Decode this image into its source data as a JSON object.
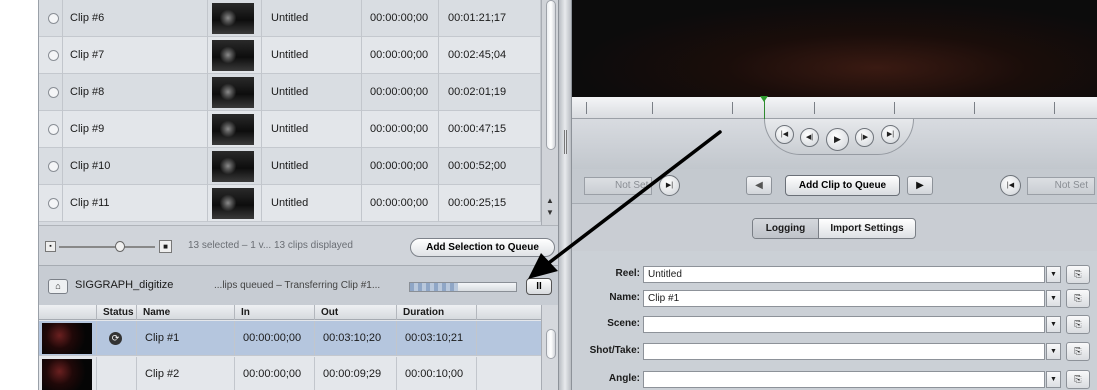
{
  "clips": [
    {
      "name": "Clip #6",
      "description": "Untitled",
      "in": "00:00:00;00",
      "out": "00:01:21;17"
    },
    {
      "name": "Clip #7",
      "description": "Untitled",
      "in": "00:00:00;00",
      "out": "00:02:45;04"
    },
    {
      "name": "Clip #8",
      "description": "Untitled",
      "in": "00:00:00;00",
      "out": "00:02:01;19"
    },
    {
      "name": "Clip #9",
      "description": "Untitled",
      "in": "00:00:00;00",
      "out": "00:00:47;15"
    },
    {
      "name": "Clip #10",
      "description": "Untitled",
      "in": "00:00:00;00",
      "out": "00:00:52;00"
    },
    {
      "name": "Clip #11",
      "description": "Untitled",
      "in": "00:00:00;00",
      "out": "00:00:25;15"
    }
  ],
  "toolbar": {
    "status": "13 selected – 1 v... 13 clips displayed",
    "add_selection_label": "Add Selection to Queue"
  },
  "batch": {
    "name": "SIGGRAPH_digitize",
    "message": "...lips queued – Transferring Clip #1...",
    "progress": 0.45,
    "pause_label": "II"
  },
  "queue": {
    "columns": [
      "Status",
      "Name",
      "In",
      "Out",
      "Duration"
    ],
    "rows": [
      {
        "name": "Clip #1",
        "in": "00:00:00;00",
        "out": "00:03:10;20",
        "duration": "00:03:10;21",
        "status_icon": "sync-icon"
      },
      {
        "name": "Clip #2",
        "in": "00:00:00;00",
        "out": "00:00:09;29",
        "duration": "00:00:10;00",
        "status_icon": ""
      }
    ]
  },
  "transport": {
    "buttons": [
      "go-to-start-icon",
      "step-back-icon",
      "play-icon",
      "step-forward-icon",
      "go-to-end-icon"
    ]
  },
  "inout": {
    "in_value": "Not Set",
    "out_value": "Not Set",
    "add_clip_label": "Add Clip to Queue"
  },
  "tabs": [
    {
      "label": "Logging",
      "active": true
    },
    {
      "label": "Import Settings",
      "active": false
    }
  ],
  "fields": [
    {
      "label": "Reel:",
      "value": "Untitled"
    },
    {
      "label": "Name:",
      "value": "Clip #1"
    },
    {
      "label": "Scene:",
      "value": ""
    },
    {
      "label": "Shot/Take:",
      "value": ""
    },
    {
      "label": "Angle:",
      "value": ""
    }
  ],
  "colors": {
    "selected_row": "#b5c6de",
    "panel_bg": "#d6dae0",
    "playhead": "#2f9a2f"
  }
}
